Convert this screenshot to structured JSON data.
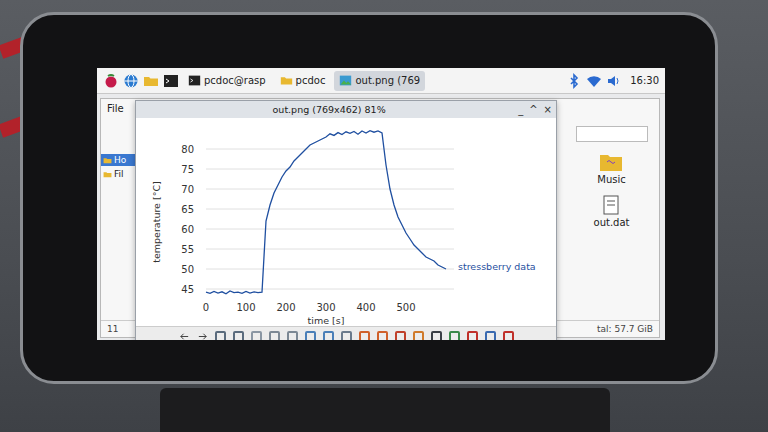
{
  "taskbar": {
    "tasks": [
      {
        "label": "pcdoc@rasp",
        "kind": "terminal",
        "selected": false
      },
      {
        "label": "pcdoc",
        "kind": "folder",
        "selected": false
      },
      {
        "label": "out.png (769",
        "kind": "image",
        "selected": true
      }
    ],
    "clock": "16:30"
  },
  "file_manager": {
    "menu": [
      "File"
    ],
    "sidebar": [
      {
        "label": "Ho",
        "selected": true
      },
      {
        "label": "Fil",
        "selected": false
      }
    ],
    "files": [
      {
        "name": "Music",
        "kind": "folder"
      },
      {
        "name": "out.dat",
        "kind": "file"
      }
    ],
    "status_left": "11",
    "status_right": "tal: 57.7 GiB"
  },
  "viewer": {
    "title": "out.png (769x462) 81%",
    "controls": [
      "_",
      "^",
      "×"
    ],
    "chart": {
      "y_label": "temperature [°C]",
      "x_label": "time [s]",
      "y_ticks": [
        "45",
        "50",
        "55",
        "60",
        "65",
        "70",
        "75",
        "80"
      ],
      "x_ticks": [
        "0",
        "100",
        "200",
        "300",
        "400",
        "500"
      ],
      "series": [
        {
          "name": "stressberry data",
          "start": 0,
          "step": 10,
          "values": [
            44.2,
            43.9,
            44.4,
            44.0,
            44.3,
            43.8,
            44.5,
            44.1,
            44.2,
            43.9,
            44.4,
            44.0,
            44.3,
            44.1,
            44.2,
            62.0,
            66.0,
            69.0,
            71.0,
            73.0,
            74.5,
            75.5,
            77.0,
            78.0,
            79.0,
            80.0,
            81.0,
            81.5,
            82.0,
            82.5,
            83.0,
            83.8,
            83.4,
            84.1,
            83.6,
            84.3,
            83.9,
            84.4,
            83.7,
            84.5,
            84.0,
            84.6,
            84.2,
            84.5,
            84.0,
            76.0,
            70.0,
            66.0,
            63.0,
            61.0,
            59.0,
            57.5,
            56.0,
            55.0,
            54.0,
            53.0,
            52.5,
            52.0,
            51.0,
            50.5,
            50.0
          ]
        }
      ]
    }
  }
}
